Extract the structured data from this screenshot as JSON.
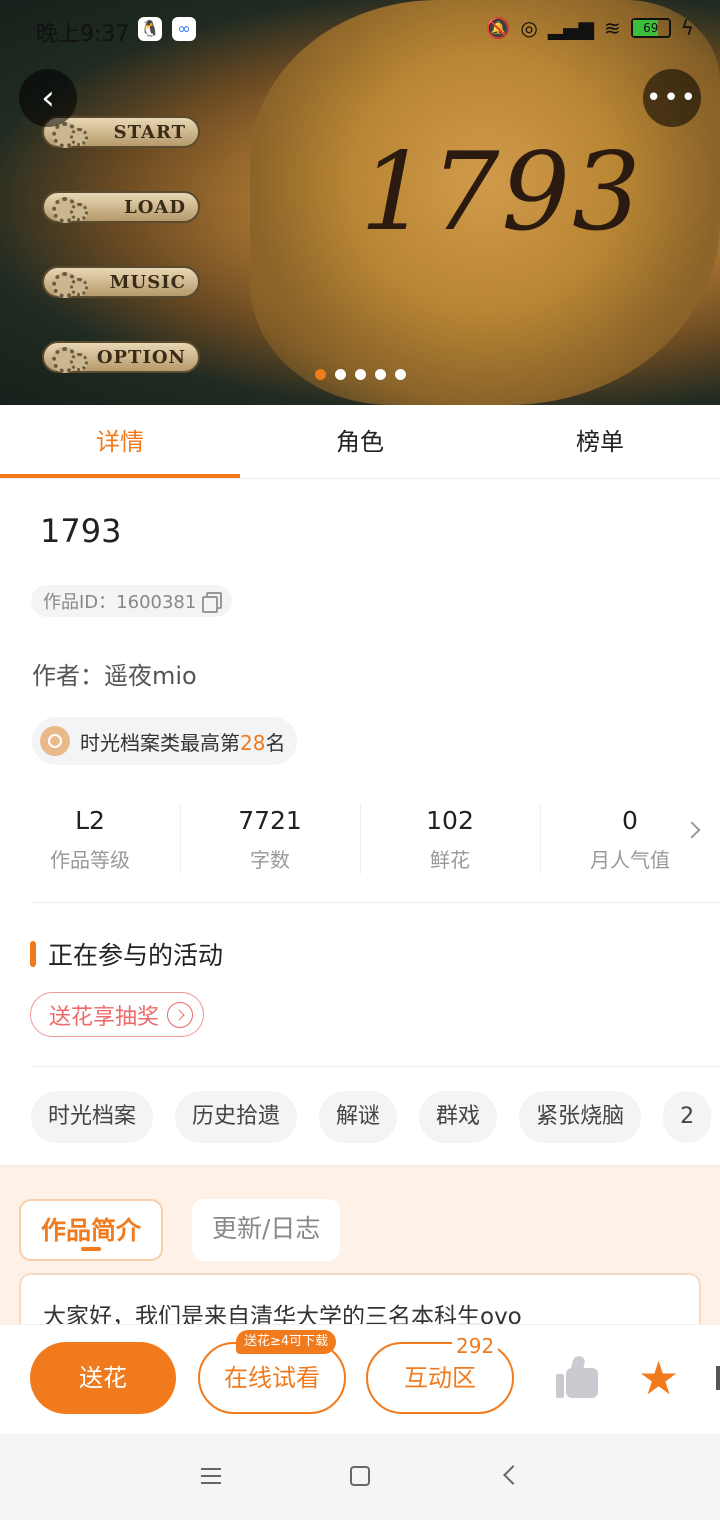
{
  "status_bar": {
    "time": "晚上9:37",
    "battery": "69"
  },
  "banner": {
    "big_title": "1793",
    "menu": [
      "START",
      "LOAD",
      "MUSIC",
      "OPTION"
    ],
    "slides_total": 5,
    "slide_active": 1
  },
  "tabs": [
    "详情",
    "角色",
    "榜单"
  ],
  "work": {
    "title": "1793",
    "id_label": "作品ID：1600381",
    "author": "作者：遥夜mio",
    "rank_prefix": "时光档案类最高第",
    "rank_num": "28",
    "rank_suffix": "名"
  },
  "stats": [
    {
      "value": "L2",
      "label": "作品等级"
    },
    {
      "value": "7721",
      "label": "字数"
    },
    {
      "value": "102",
      "label": "鲜花"
    },
    {
      "value": "0",
      "label": "月人气值"
    }
  ],
  "activities": {
    "heading": "正在参与的活动",
    "pill": "送花享抽奖"
  },
  "tags": [
    "时光档案",
    "历史拾遗",
    "解谜",
    "群戏",
    "紧张烧脑",
    "2"
  ],
  "intro": {
    "tab_active": "作品简介",
    "tab_other": "更新/日志",
    "text": "大家好，我们是来自清华大学的三名本科生ovo"
  },
  "bottom": {
    "flower": "送花",
    "trial": "在线试看",
    "trial_badge": "送花≥4可下载",
    "forum": "互动区",
    "forum_count": "292"
  },
  "colors": {
    "accent": "#f07a1c",
    "activity_red": "#ee6a6a"
  }
}
